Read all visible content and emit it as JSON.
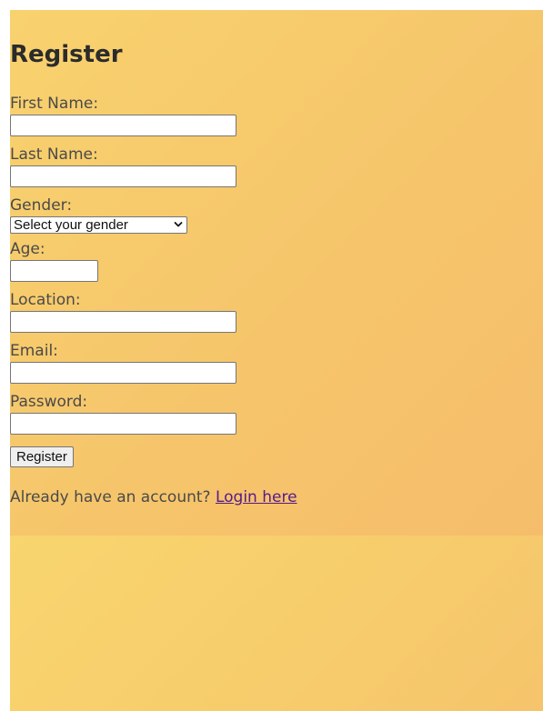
{
  "page": {
    "title": "Register"
  },
  "form": {
    "first_name_label": "First Name:",
    "first_name_value": "",
    "last_name_label": "Last Name:",
    "last_name_value": "",
    "gender_label": "Gender:",
    "gender_selected": "Select your gender",
    "age_label": "Age:",
    "age_value": "",
    "location_label": "Location:",
    "location_value": "",
    "email_label": "Email:",
    "email_value": "",
    "password_label": "Password:",
    "password_value": "",
    "submit_label": "Register"
  },
  "footer": {
    "prompt_text": "Already have an account?",
    "login_link_text": "Login here"
  },
  "colors": {
    "background_gradient_start": "#f8d26e",
    "background_gradient_end": "#f5bd6b",
    "link": "#551a8b",
    "text": "#4a4a4a"
  },
  "icons": {
    "gender_dropdown": "chevron-down-icon"
  }
}
